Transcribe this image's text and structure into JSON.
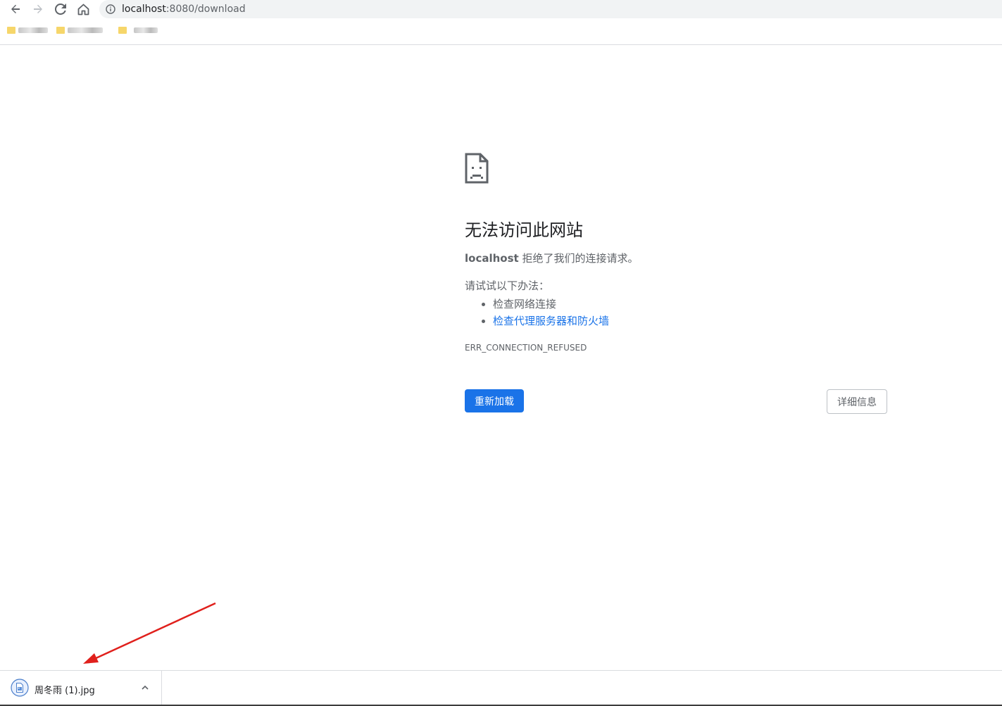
{
  "browser": {
    "url_host": "localhost",
    "url_port_path": ":8080/download",
    "nav": {
      "back": "back-arrow-icon",
      "forward": "forward-arrow-icon",
      "reload": "reload-icon",
      "home": "home-icon"
    }
  },
  "bookmarks": [
    {
      "icon": "folder-icon"
    },
    {
      "icon": "folder-icon"
    },
    {
      "icon": "folder-icon"
    }
  ],
  "error": {
    "icon": "sad-document-icon",
    "title": "无法访问此网站",
    "host": "localhost",
    "message": " 拒绝了我们的连接请求。",
    "try_label": "请试试以下办法：",
    "suggestions": [
      "检查网络连接",
      "检查代理服务器和防火墙"
    ],
    "code": "ERR_CONNECTION_REFUSED",
    "reload_label": "重新加载",
    "details_label": "详细信息"
  },
  "download_shelf": {
    "file_name": "周冬雨 (1).jpg",
    "file_icon": "image-file-icon",
    "menu_icon": "chevron-up-icon"
  },
  "colors": {
    "primary_button": "#1a73e8",
    "link": "#1a73e8",
    "annotation_arrow": "#e0201c",
    "text_secondary": "#5f6368"
  }
}
